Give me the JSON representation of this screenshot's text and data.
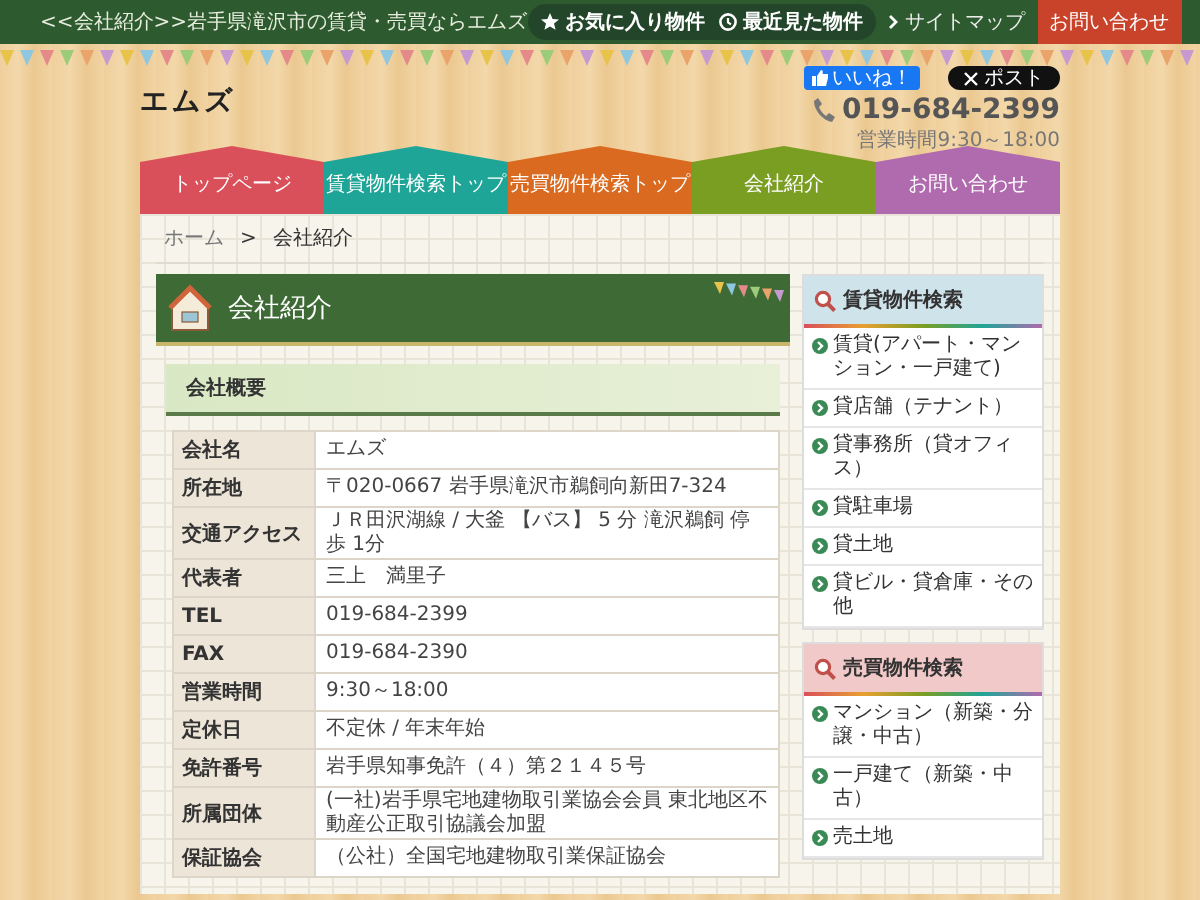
{
  "top_bar": {
    "tagline": "<<会社紹介>>岩手県滝沢市の賃貸・売買ならエムズ",
    "links": [
      {
        "kind": "star",
        "label": "お気に入り物件"
      },
      {
        "kind": "history",
        "label": "最近見た物件"
      }
    ],
    "sitemap": "サイトマップ",
    "contact": "お問い合わせ"
  },
  "header": {
    "logo": "エムズ",
    "like": "いいね！",
    "post": "ポスト",
    "phone": "019-684-2399",
    "hours": "営業時間9:30～18:00"
  },
  "nav": [
    {
      "label": "トップページ",
      "color": "#d9505a"
    },
    {
      "label": "賃貸物件検索トップ",
      "color": "#1fa597"
    },
    {
      "label": "売買物件検索トップ",
      "color": "#d96a1f"
    },
    {
      "label": "会社紹介",
      "color": "#7a9e22"
    },
    {
      "label": "お問い合わせ",
      "color": "#b06aae"
    }
  ],
  "breadcrumb": {
    "home": "ホーム",
    "separator": ">",
    "current": "会社紹介"
  },
  "page_title": "会社紹介",
  "section_title": "会社概要",
  "table": {
    "rows": [
      {
        "label": "会社名",
        "value": "エムズ"
      },
      {
        "label": "所在地",
        "value": "〒020-0667 岩手県滝沢市鵜飼向新田7-324"
      },
      {
        "label": "交通アクセス",
        "value": "ＪＲ田沢湖線 / 大釜 【バス】 5 分 滝沢鵜飼 停歩 1分"
      },
      {
        "label": "代表者",
        "value": "三上　満里子"
      },
      {
        "label": "TEL",
        "value": "019-684-2399"
      },
      {
        "label": "FAX",
        "value": "019-684-2390"
      },
      {
        "label": "営業時間",
        "value": "9:30～18:00"
      },
      {
        "label": "定休日",
        "value": "不定休 / 年末年始"
      },
      {
        "label": "免許番号",
        "value": "岩手県知事免許（４）第２１４５号"
      },
      {
        "label": "所属団体",
        "value": "(一社)岩手県宅地建物取引業協会会員 東北地区不動産公正取引協議会加盟"
      },
      {
        "label": "保証協会",
        "value": "（公社）全国宅地建物取引業保証協会"
      }
    ]
  },
  "sidebar": [
    {
      "title": "賃貸物件検索",
      "color": "#cfe3ea",
      "items": [
        "賃貸(アパート・マンション・一戸建て)",
        "貸店舗（テナント）",
        "貸事務所（貸オフィス）",
        "貸駐車場",
        "貸土地",
        "貸ビル・貸倉庫・その他"
      ]
    },
    {
      "title": "売買物件検索",
      "color": "#f2c9c9",
      "items": [
        "マンション（新築・分譲・中古）",
        "一戸建て（新築・中古）",
        "売土地"
      ]
    }
  ]
}
